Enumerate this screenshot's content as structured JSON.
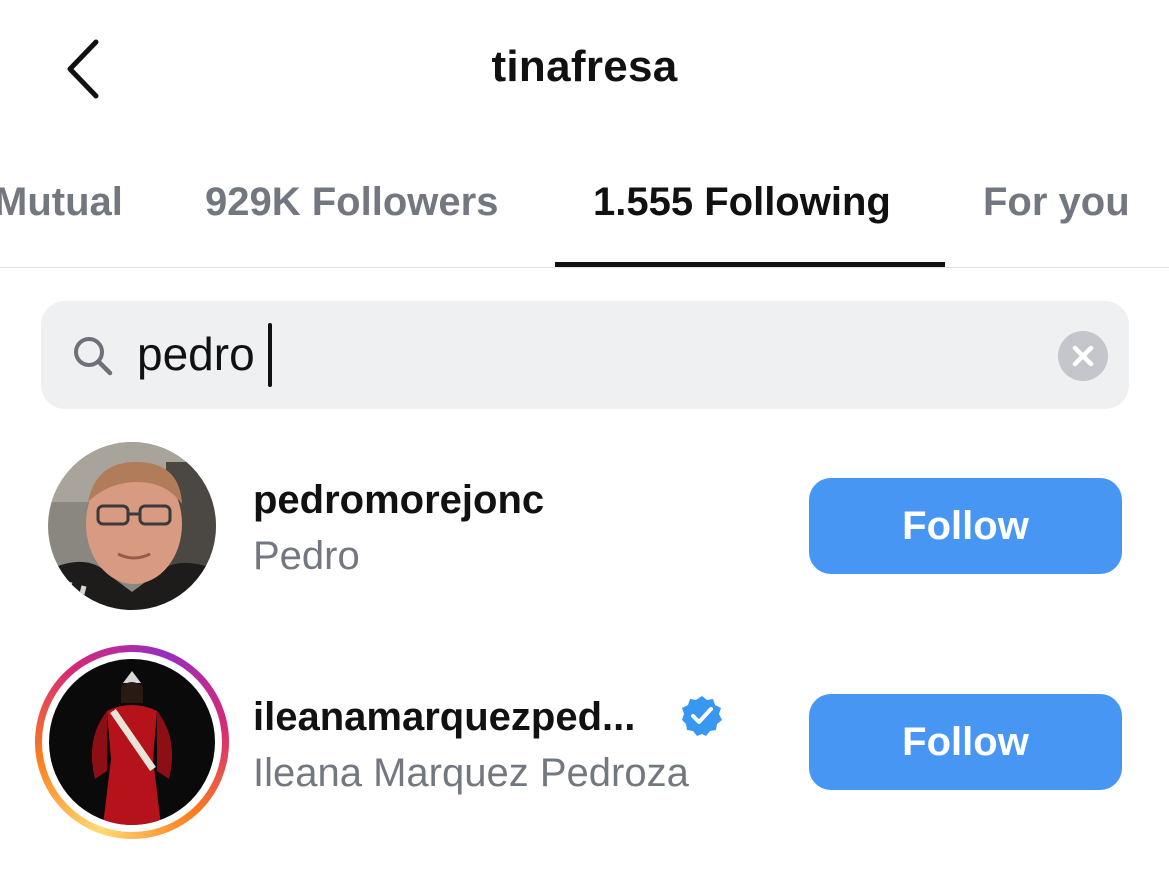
{
  "header": {
    "title": "tinafresa",
    "back_icon": "chevron-left-icon"
  },
  "tabs": [
    {
      "label": "Mutual",
      "active": false
    },
    {
      "label": "929K Followers",
      "active": false
    },
    {
      "label": "1.555 Following",
      "active": true
    },
    {
      "label": "For you",
      "active": false
    }
  ],
  "search": {
    "value": "pedro",
    "icon": "search-icon",
    "clear_icon": "clear-icon"
  },
  "results": [
    {
      "username": "pedromorejonc",
      "full_name": "Pedro",
      "verified": false,
      "story_ring": false,
      "button_label": "Follow"
    },
    {
      "username": "ileanamarquezped...",
      "full_name": "Ileana Marquez Pedroza",
      "verified": true,
      "story_ring": true,
      "button_label": "Follow"
    }
  ],
  "colors": {
    "accent": "#4796f4",
    "verified": "#3897f0",
    "muted_text": "#737880",
    "search_bg": "#eff0f2"
  }
}
